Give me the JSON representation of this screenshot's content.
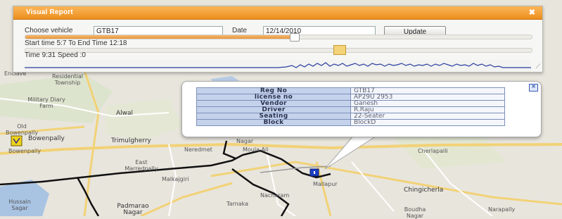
{
  "panel": {
    "title": "Visual Report",
    "close_icon": "close-icon",
    "choose_vehicle_label": "Choose vehicle",
    "vehicle_value": "GTB17",
    "date_label": "Date",
    "date_value": "12/14/2010",
    "update_label": "Update",
    "time_range_text": "Start time 5:7 To End Time 12:18",
    "status_text": "Time 9:31 Speed :0",
    "slider1_progress": 0.53,
    "slider2_position": 0.62,
    "accent_color": "#f2a33c"
  },
  "popup": {
    "rows": [
      {
        "key": "Reg No",
        "value": "GTB17"
      },
      {
        "key": "license no",
        "value": "AP29U 2953"
      },
      {
        "key": "Vendor",
        "value": "Ganesh"
      },
      {
        "key": "Driver",
        "value": "R.Raju"
      },
      {
        "key": "Seating",
        "value": "22-Seater"
      },
      {
        "key": "Block",
        "value": "BlockD"
      }
    ]
  },
  "map": {
    "labels": {
      "enclave": "Enclave",
      "residential": "Residential Township",
      "military": "Military Diary Farm",
      "alwal": "Alwal",
      "old_bowenpally": "Old Bowenpally",
      "bowenpally": "Bowenpally",
      "bowenpally2": "Bowenpally",
      "trimulgherry": "Trimulgherry",
      "neredmet": "Neredmet",
      "nagar": "Nagar",
      "moula_ali": "Moula Ali",
      "cherlapalli": "Cherlapalli",
      "east_marredpally": "East Marredpally",
      "malkajgiri": "Malkajgiri",
      "mallapur": "Mallapur",
      "nacharam": "Nacharam",
      "chingicherla": "Chingicherla",
      "hussain_sagar": "Hussain Sagar",
      "padmarao": "Padmarao Nagar",
      "tarnaka": "Tarnaka",
      "boudha": "Boudha Nagar",
      "narapally": "Narapally"
    }
  }
}
